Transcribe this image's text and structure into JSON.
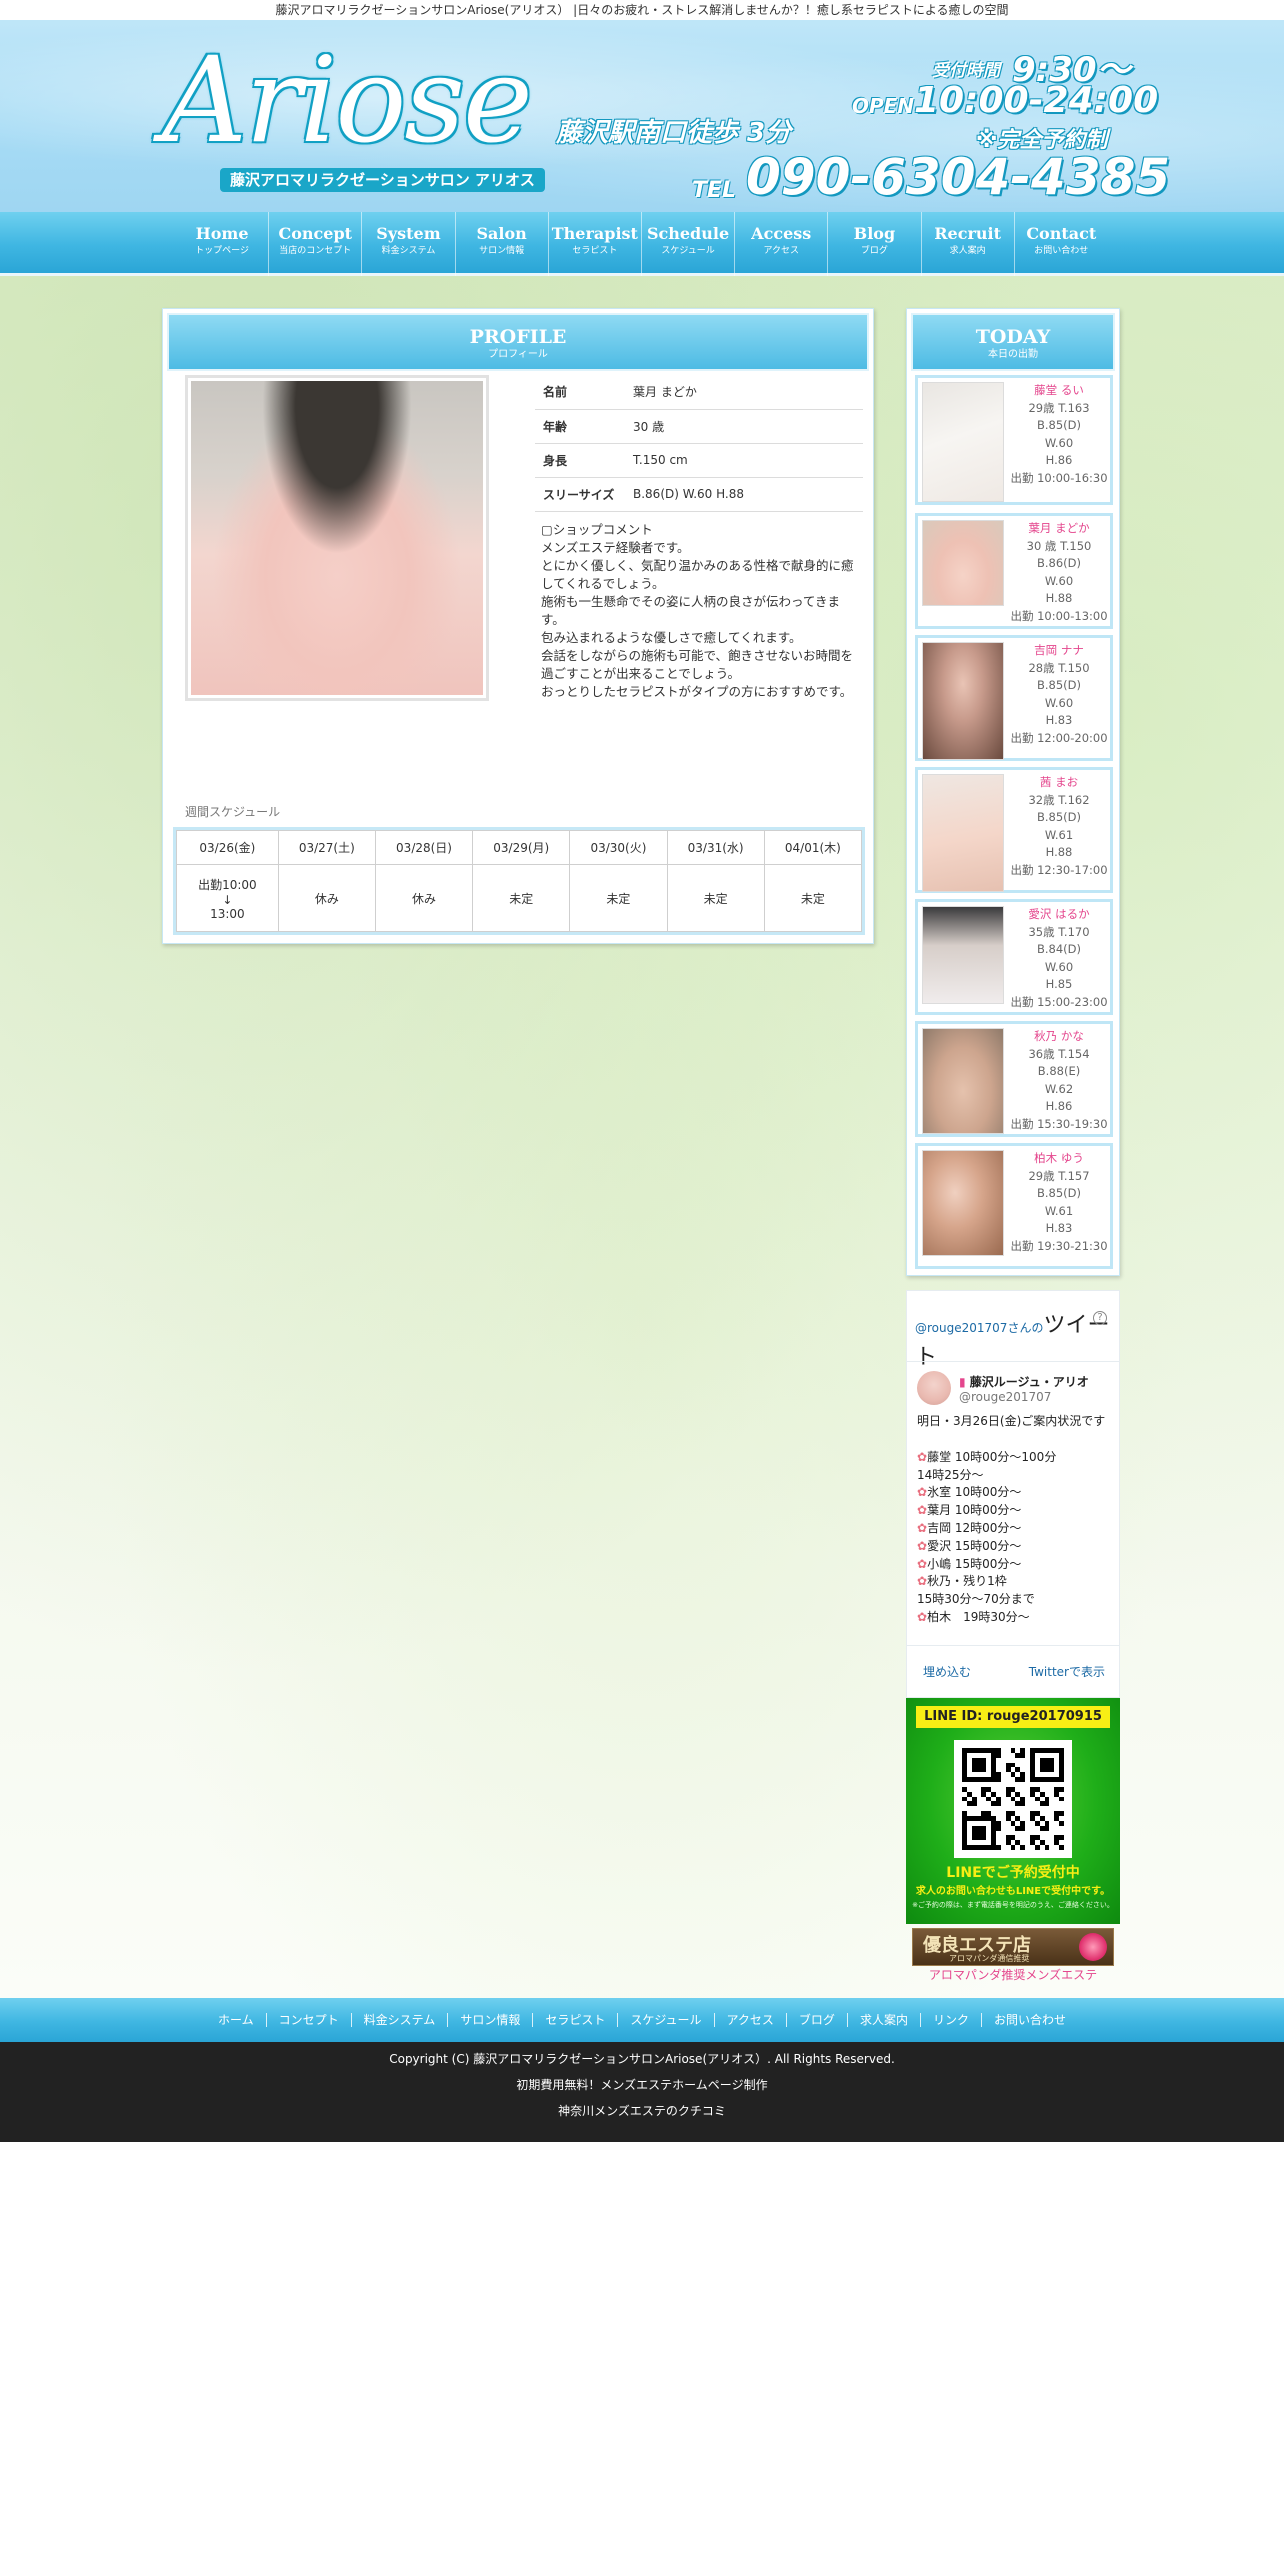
{
  "top_strip": "藤沢アロマリラクゼーションサロンAriose(アリオス） |日々のお疲れ・ストレス解消しませんか？！癒し系セラピストによる癒しの空間",
  "header": {
    "logo": "Ariose",
    "logo_sub": "藤沢アロマリラクゼーションサロン アリオス",
    "station": "藤沢駅南口徒歩 3分",
    "hours_label": "受付時間",
    "hours_time": "9:30〜",
    "open_label": "OPEN",
    "open_time": "10:00-24:00",
    "reservation": "※完全予約制",
    "tel_label": "TEL",
    "tel_number": "090-6304-4385"
  },
  "nav": [
    {
      "en": "Home",
      "jp": "トップページ"
    },
    {
      "en": "Concept",
      "jp": "当店のコンセプト"
    },
    {
      "en": "System",
      "jp": "料金システム"
    },
    {
      "en": "Salon",
      "jp": "サロン情報"
    },
    {
      "en": "Therapist",
      "jp": "セラピスト"
    },
    {
      "en": "Schedule",
      "jp": "スケジュール"
    },
    {
      "en": "Access",
      "jp": "アクセス"
    },
    {
      "en": "Blog",
      "jp": "ブログ"
    },
    {
      "en": "Recruit",
      "jp": "求人案内"
    },
    {
      "en": "Contact",
      "jp": "お問い合わせ"
    }
  ],
  "profile": {
    "title_en": "PROFILE",
    "title_jp": "プロフィール",
    "rows": [
      {
        "label": "名前",
        "value": "葉月 まどか"
      },
      {
        "label": "年齢",
        "value": "30 歳"
      },
      {
        "label": "身長",
        "value": "T.150 cm"
      },
      {
        "label": "スリーサイズ",
        "value": "B.86(D) W.60 H.88"
      }
    ],
    "comment_title": "▢ショップコメント",
    "comment_lines": [
      "メンズエステ経験者です。",
      "とにかく優しく、気配り温かみのある性格で献身的に癒してくれるでしょう。",
      "施術も一生懸命でその姿に人柄の良さが伝わってきます。",
      "包み込まれるような優しさで癒してくれます。",
      "会話をしながらの施術も可能で、飽きさせないお時間を過ごすことが出来ることでしょう。",
      "おっとりしたセラピストがタイプの方におすすめです。"
    ]
  },
  "schedule": {
    "title": "週間スケジュール",
    "days": [
      "03/26(金)",
      "03/27(土)",
      "03/28(日)",
      "03/29(月)",
      "03/30(火)",
      "03/31(水)",
      "04/01(木)"
    ],
    "first_day": [
      "出勤10:00",
      "↓",
      "13:00"
    ],
    "others": [
      "休み",
      "休み",
      "未定",
      "未定",
      "未定",
      "未定"
    ]
  },
  "today": {
    "title_en": "TODAY",
    "title_jp": "本日の出勤",
    "therapists": [
      {
        "name": "藤堂 るい",
        "age_height": "29歳 T.163",
        "b": "B.85(D)",
        "w": "W.60",
        "h": "H.86",
        "time": "出勤 10:00-16:30"
      },
      {
        "name": "葉月 まどか",
        "age_height": "30 歳 T.150",
        "b": "B.86(D)",
        "w": "W.60",
        "h": "H.88",
        "time": "出勤 10:00-13:00"
      },
      {
        "name": "吉岡 ナナ",
        "age_height": "28歳 T.150",
        "b": "B.85(D)",
        "w": "W.60",
        "h": "H.83",
        "time": "出勤 12:00-20:00"
      },
      {
        "name": "茜 まお",
        "age_height": "32歳 T.162",
        "b": "B.85(D)",
        "w": "W.61",
        "h": "H.88",
        "time": "出勤 12:30-17:00"
      },
      {
        "name": "愛沢 はるか",
        "age_height": "35歳 T.170",
        "b": "B.84(D)",
        "w": "W.60",
        "h": "H.85",
        "time": "出勤 15:00-23:00"
      },
      {
        "name": "秋乃 かな",
        "age_height": "36歳 T.154",
        "b": "B.88(E)",
        "w": "W.62",
        "h": "H.86",
        "time": "出勤 15:30-19:30"
      },
      {
        "name": "柏木 ゆう",
        "age_height": "29歳 T.157",
        "b": "B.85(D)",
        "w": "W.61",
        "h": "H.83",
        "time": "出勤 19:30-21:30"
      }
    ]
  },
  "twitter": {
    "handle_link": "@rouge201707",
    "san": "さんの",
    "tweet_word": "ツイート",
    "account_name": "藤沢ルージュ・アリオ",
    "account_handle": "@rouge201707",
    "intro": "明日・3月26日(金)ご案内状況です",
    "lines": [
      "藤堂 10時00分〜100分",
      "14時25分～",
      "氷室 10時00分～",
      "葉月 10時00分～",
      "吉岡 12時00分～",
      "愛沢 15時00分～",
      "小嶋 15時00分～",
      "秋乃・残り1枠",
      "15時30分～70分まで",
      "柏木　19時30分～"
    ],
    "flower_lines": [
      true,
      false,
      true,
      true,
      true,
      true,
      true,
      true,
      false,
      true
    ],
    "embed": "埋め込む",
    "view": "Twitterで表示"
  },
  "line_banner": {
    "id": "LINE ID:  rouge20170915",
    "cta": "LINEでご予約受付中",
    "sub": "求人のお問い合わせもLINEで受付中です。",
    "note": "※ご予約の際は、まず電話番号を明記のうえ、ご連絡ください。"
  },
  "panda_banner": {
    "title": "優良エステ店",
    "sub": "アロマパンダ通信推奨",
    "caption": "アロマパンダ推奨メンズエステ"
  },
  "footer_nav": [
    "ホーム",
    "コンセプト",
    "料金システム",
    "サロン情報",
    "セラピスト",
    "スケジュール",
    "アクセス",
    "ブログ",
    "求人案内",
    "リンク",
    "お問い合わせ"
  ],
  "footer": {
    "copyright": "Copyright (C) 藤沢アロマリラクゼーションサロンAriose(アリオス）. All Rights Reserved.",
    "line2": "初期費用無料！メンズエステホームページ制作",
    "line3": "神奈川メンズエステのクチコミ"
  },
  "colors": {
    "accent": "#3fb6e2",
    "name_pink": "#e4468d",
    "footer_bg": "#222222"
  }
}
